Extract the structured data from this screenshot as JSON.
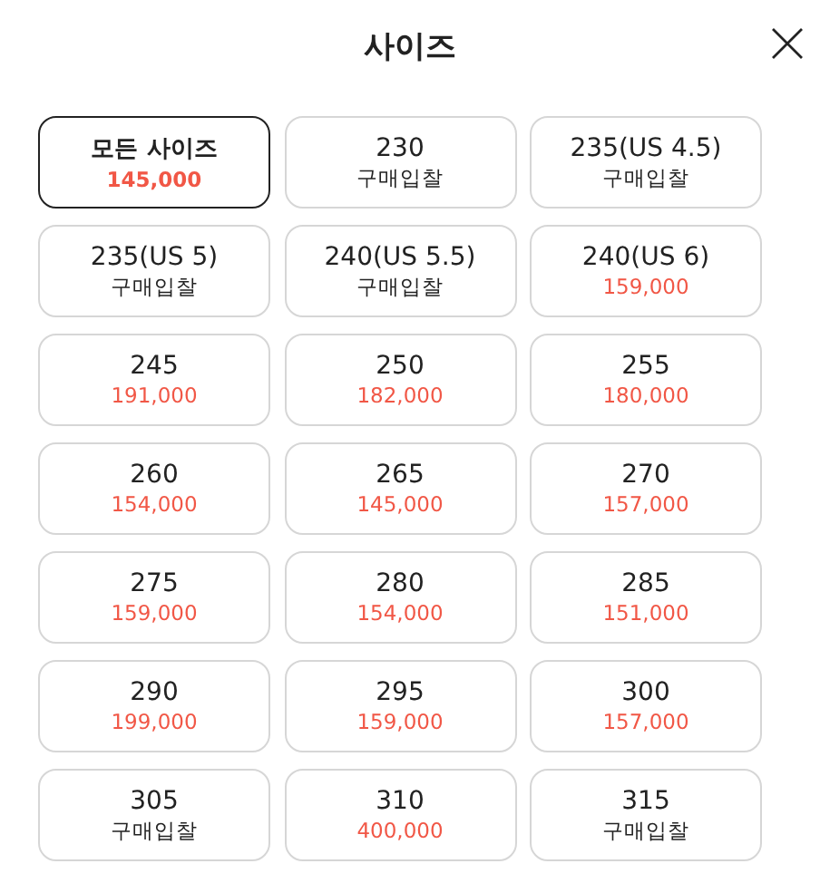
{
  "header": {
    "title": "사이즈"
  },
  "sizes": [
    {
      "size": "모든 사이즈",
      "sub": "145,000",
      "kind": "price",
      "selected": true
    },
    {
      "size": "230",
      "sub": "구매입찰",
      "kind": "bid",
      "selected": false
    },
    {
      "size": "235(US 4.5)",
      "sub": "구매입찰",
      "kind": "bid",
      "selected": false
    },
    {
      "size": "235(US 5)",
      "sub": "구매입찰",
      "kind": "bid",
      "selected": false
    },
    {
      "size": "240(US 5.5)",
      "sub": "구매입찰",
      "kind": "bid",
      "selected": false
    },
    {
      "size": "240(US 6)",
      "sub": "159,000",
      "kind": "price",
      "selected": false
    },
    {
      "size": "245",
      "sub": "191,000",
      "kind": "price",
      "selected": false
    },
    {
      "size": "250",
      "sub": "182,000",
      "kind": "price",
      "selected": false
    },
    {
      "size": "255",
      "sub": "180,000",
      "kind": "price",
      "selected": false
    },
    {
      "size": "260",
      "sub": "154,000",
      "kind": "price",
      "selected": false
    },
    {
      "size": "265",
      "sub": "145,000",
      "kind": "price",
      "selected": false
    },
    {
      "size": "270",
      "sub": "157,000",
      "kind": "price",
      "selected": false
    },
    {
      "size": "275",
      "sub": "159,000",
      "kind": "price",
      "selected": false
    },
    {
      "size": "280",
      "sub": "154,000",
      "kind": "price",
      "selected": false
    },
    {
      "size": "285",
      "sub": "151,000",
      "kind": "price",
      "selected": false
    },
    {
      "size": "290",
      "sub": "199,000",
      "kind": "price",
      "selected": false
    },
    {
      "size": "295",
      "sub": "159,000",
      "kind": "price",
      "selected": false
    },
    {
      "size": "300",
      "sub": "157,000",
      "kind": "price",
      "selected": false
    },
    {
      "size": "305",
      "sub": "구매입찰",
      "kind": "bid",
      "selected": false
    },
    {
      "size": "310",
      "sub": "400,000",
      "kind": "price",
      "selected": false
    },
    {
      "size": "315",
      "sub": "구매입찰",
      "kind": "bid",
      "selected": false
    }
  ]
}
